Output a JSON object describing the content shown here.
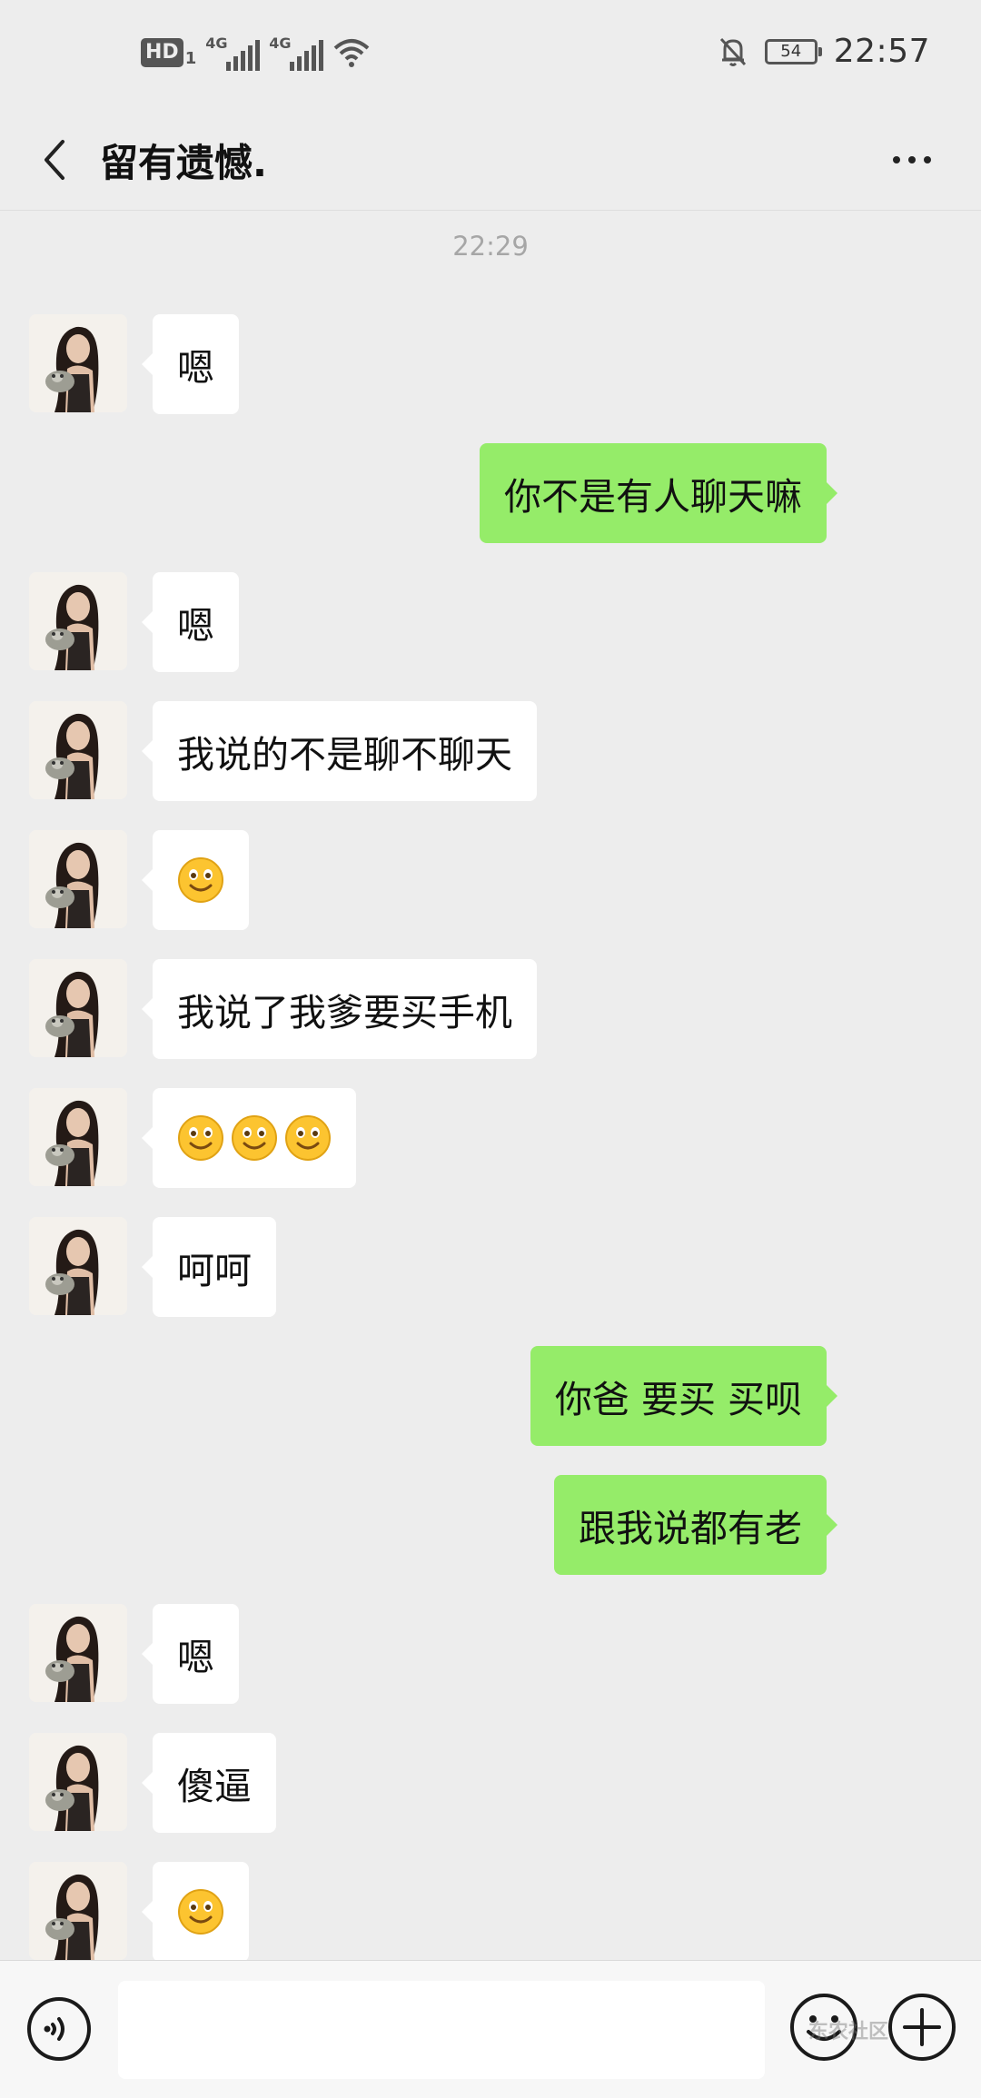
{
  "status_bar": {
    "hd_label": "HD",
    "hd_sub": "1",
    "network1": "4G",
    "network2": "4G",
    "battery_level": "54",
    "time": "22:57"
  },
  "header": {
    "title": "留有遗憾."
  },
  "chat": {
    "timestamp": "22:29",
    "messages": [
      {
        "from": "contact",
        "text": "嗯"
      },
      {
        "from": "me",
        "text": "你不是有人聊天嘛"
      },
      {
        "from": "contact",
        "text": "嗯"
      },
      {
        "from": "contact",
        "text": "我说的不是聊不聊天"
      },
      {
        "from": "contact",
        "emoji_count": 1,
        "emoji": "smile-emoji"
      },
      {
        "from": "contact",
        "text": "我说了我爹要买手机"
      },
      {
        "from": "contact",
        "emoji_count": 3,
        "emoji": "smile-emoji"
      },
      {
        "from": "contact",
        "text": "呵呵"
      },
      {
        "from": "me",
        "text": "你爸 要买 买呗"
      },
      {
        "from": "me",
        "text": "跟我说都有老"
      },
      {
        "from": "contact",
        "text": "嗯"
      },
      {
        "from": "contact",
        "text": "傻逼"
      },
      {
        "from": "contact",
        "emoji_count": 1,
        "emoji": "smile-emoji"
      }
    ]
  },
  "input": {
    "value": "",
    "watermark": "东农社区"
  },
  "colors": {
    "background": "#ededed",
    "sent_bubble": "#95ec69",
    "received_bubble": "#ffffff"
  }
}
